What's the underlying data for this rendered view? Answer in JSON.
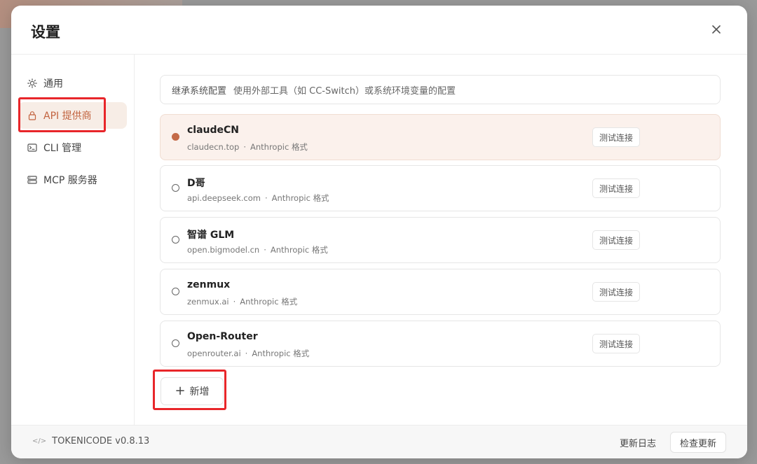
{
  "dialog": {
    "title": "设置"
  },
  "sidebar": {
    "items": [
      {
        "label": "通用",
        "icon": "sun-icon",
        "active": false
      },
      {
        "label": "API 提供商",
        "icon": "lock-icon",
        "active": true
      },
      {
        "label": "CLI 管理",
        "icon": "terminal-icon",
        "active": false
      },
      {
        "label": "MCP 服务器",
        "icon": "server-icon",
        "active": false
      }
    ]
  },
  "main": {
    "inherit": {
      "title": "继承系统配置",
      "description": "使用外部工具（如 CC-Switch）或系统环境变量的配置"
    },
    "providers": [
      {
        "name": "claudeCN",
        "host": "claudecn.top",
        "format": "Anthropic 格式",
        "selected": true,
        "test_label": "测试连接"
      },
      {
        "name": "D哥",
        "host": "api.deepseek.com",
        "format": "Anthropic 格式",
        "selected": false,
        "test_label": "测试连接"
      },
      {
        "name": "智谱 GLM",
        "host": "open.bigmodel.cn",
        "format": "Anthropic 格式",
        "selected": false,
        "test_label": "测试连接"
      },
      {
        "name": "zenmux",
        "host": "zenmux.ai",
        "format": "Anthropic 格式",
        "selected": false,
        "test_label": "测试连接"
      },
      {
        "name": "Open-Router",
        "host": "openrouter.ai",
        "format": "Anthropic 格式",
        "selected": false,
        "test_label": "测试连接"
      }
    ],
    "meta_separator": "·",
    "add_label": "新增"
  },
  "footer": {
    "version": "TOKENICODE v0.8.13",
    "changelog_label": "更新日志",
    "check_update_label": "检查更新"
  },
  "colors": {
    "accent": "#c2633f",
    "selected_bg": "#fbf1ec",
    "highlight": "#e8262a"
  }
}
